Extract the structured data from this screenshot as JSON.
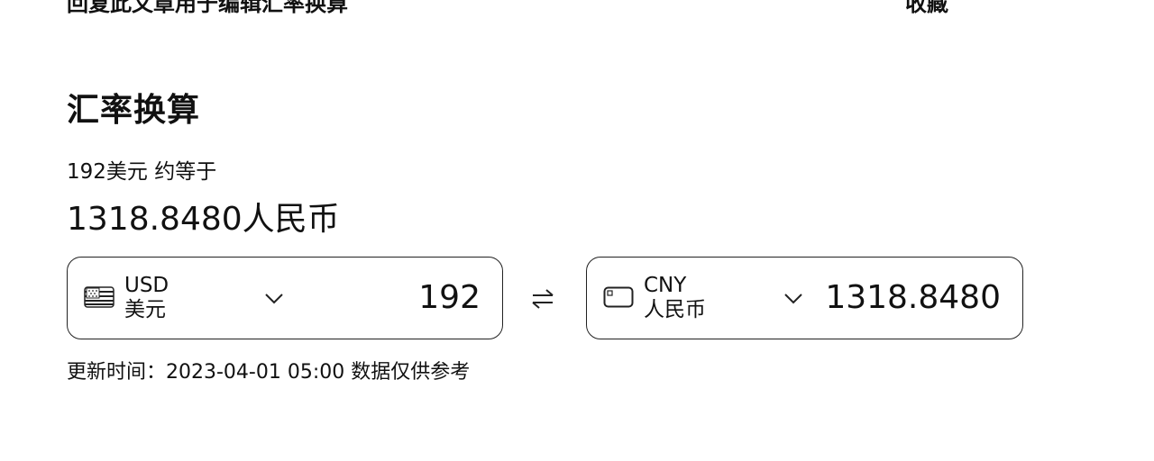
{
  "top_clipped": {
    "left_text": "回复此文章用于编辑汇率换算",
    "right_text": "收藏"
  },
  "converter": {
    "title": "汇率换算",
    "summary": "192美元 约等于",
    "result": "1318.8480人民币",
    "from": {
      "code": "USD",
      "name": "美元",
      "amount": "192",
      "icon": "us-flag-icon"
    },
    "to": {
      "code": "CNY",
      "name": "人民币",
      "amount": "1318.8480",
      "icon": "currency-card-icon"
    },
    "swap_icon": "swap-arrows-icon",
    "footer": "更新时间：2023-04-01 05:00 数据仅供参考"
  }
}
